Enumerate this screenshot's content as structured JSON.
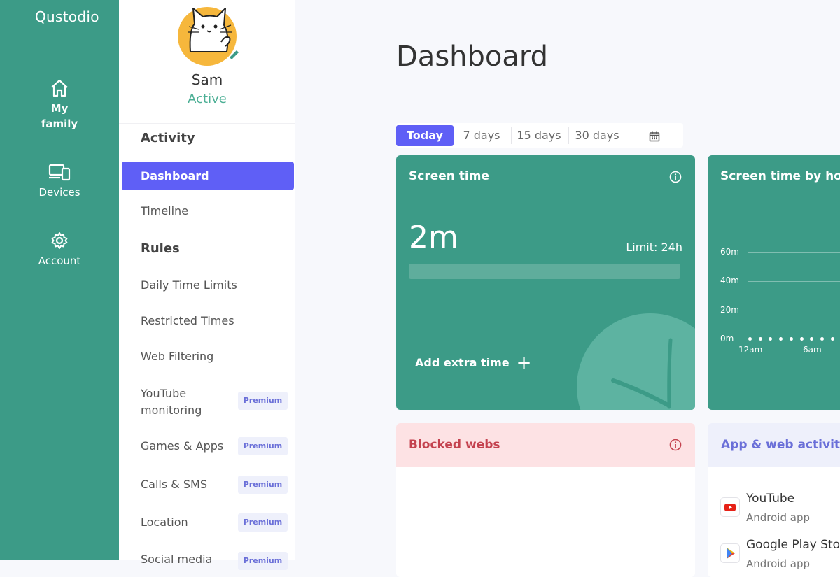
{
  "rail": {
    "brand": "Qustodio",
    "items": [
      {
        "label_line1": "My",
        "label_line2": "family"
      },
      {
        "label": "Devices"
      },
      {
        "label": "Account"
      }
    ]
  },
  "profile": {
    "name": "Sam",
    "status": "Active"
  },
  "sidebar": {
    "activity_heading": "Activity",
    "dashboard": "Dashboard",
    "timeline": "Timeline",
    "rules_heading": "Rules",
    "items": [
      {
        "label": "Daily Time Limits"
      },
      {
        "label": "Restricted Times"
      },
      {
        "label": "Web Filtering"
      },
      {
        "label_line1": "YouTube",
        "label_line2": "monitoring",
        "badge": "Premium"
      },
      {
        "label": "Games & Apps",
        "badge": "Premium"
      },
      {
        "label": "Calls & SMS",
        "badge": "Premium"
      },
      {
        "label": "Location",
        "badge": "Premium"
      },
      {
        "label": "Social media",
        "badge": "Premium"
      }
    ]
  },
  "main": {
    "title": "Dashboard",
    "ranges": [
      "Today",
      "7 days",
      "15 days",
      "30 days"
    ],
    "active_range": "Today"
  },
  "screen_time": {
    "title": "Screen time",
    "value": "2m",
    "limit": "Limit: 24h",
    "progress_fraction": 0.0,
    "add_extra": "Add extra time",
    "plus": "+"
  },
  "hourly": {
    "title": "Screen time by hour",
    "y_ticks": [
      "60m",
      "40m",
      "20m",
      "0m"
    ],
    "x_ticks": [
      "12am",
      "6am"
    ]
  },
  "blocked": {
    "title": "Blocked webs"
  },
  "app_activity": {
    "title": "App & web activity",
    "apps": [
      {
        "name": "YouTube",
        "sub": "Android app",
        "icon": "youtube-icon"
      },
      {
        "name": "Google Play Store",
        "sub": "Android app",
        "icon": "google-play-icon"
      }
    ]
  },
  "colors": {
    "brand_green": "#3c9b87",
    "accent_purple": "#5f5ff6",
    "blocked_red": "#c4424f"
  }
}
